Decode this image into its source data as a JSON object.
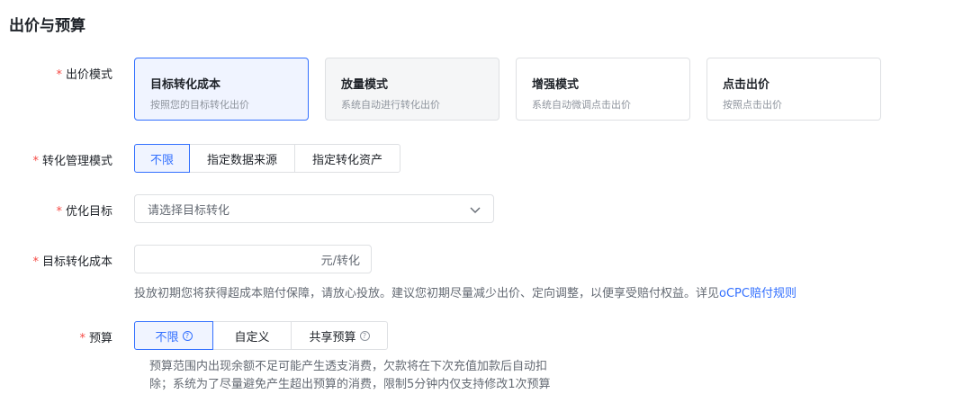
{
  "section_title": "出价与预算",
  "required_mark": "*",
  "bid_mode": {
    "label": "出价模式",
    "cards": [
      {
        "title": "目标转化成本",
        "desc": "按照您的目标转化出价",
        "state": "selected"
      },
      {
        "title": "放量模式",
        "desc": "系统自动进行转化出价",
        "state": "disabled"
      },
      {
        "title": "增强模式",
        "desc": "系统自动微调点击出价",
        "state": "normal"
      },
      {
        "title": "点击出价",
        "desc": "按照点击出价",
        "state": "normal"
      }
    ]
  },
  "conversion_mode": {
    "label": "转化管理模式",
    "options": [
      "不限",
      "指定数据来源",
      "指定转化资产"
    ],
    "selected": "不限"
  },
  "optimization_target": {
    "label": "优化目标",
    "placeholder": "请选择目标转化",
    "icon": "chevron-down-icon"
  },
  "target_cost": {
    "label": "目标转化成本",
    "value": "",
    "suffix": "元/转化",
    "hint_prefix": "投放初期您将获得超成本赔付保障，请放心投放。建议您初期尽量减少出价、定向调整，以便享受赔付权益。详见",
    "hint_link": "oCPC赔付规则"
  },
  "budget": {
    "label": "预算",
    "options": [
      {
        "text": "不限",
        "help": true
      },
      {
        "text": "自定义",
        "help": false
      },
      {
        "text": "共享预算",
        "help": true
      }
    ],
    "selected": "不限",
    "help_glyph": "?",
    "help_icon": "question-circle-icon",
    "hint_line1": "预算范围内出现余额不足可能产生透支消费，欠款将在下次充值加款后自动扣",
    "hint_line2": "除；系统为了尽量避免产生超出预算的消费，限制5分钟内仅支持修改1次预算"
  },
  "colors": {
    "accent": "#3370ff",
    "required": "#f54a45",
    "border": "#dee0e3",
    "selected_bg": "#f0f4ff"
  }
}
